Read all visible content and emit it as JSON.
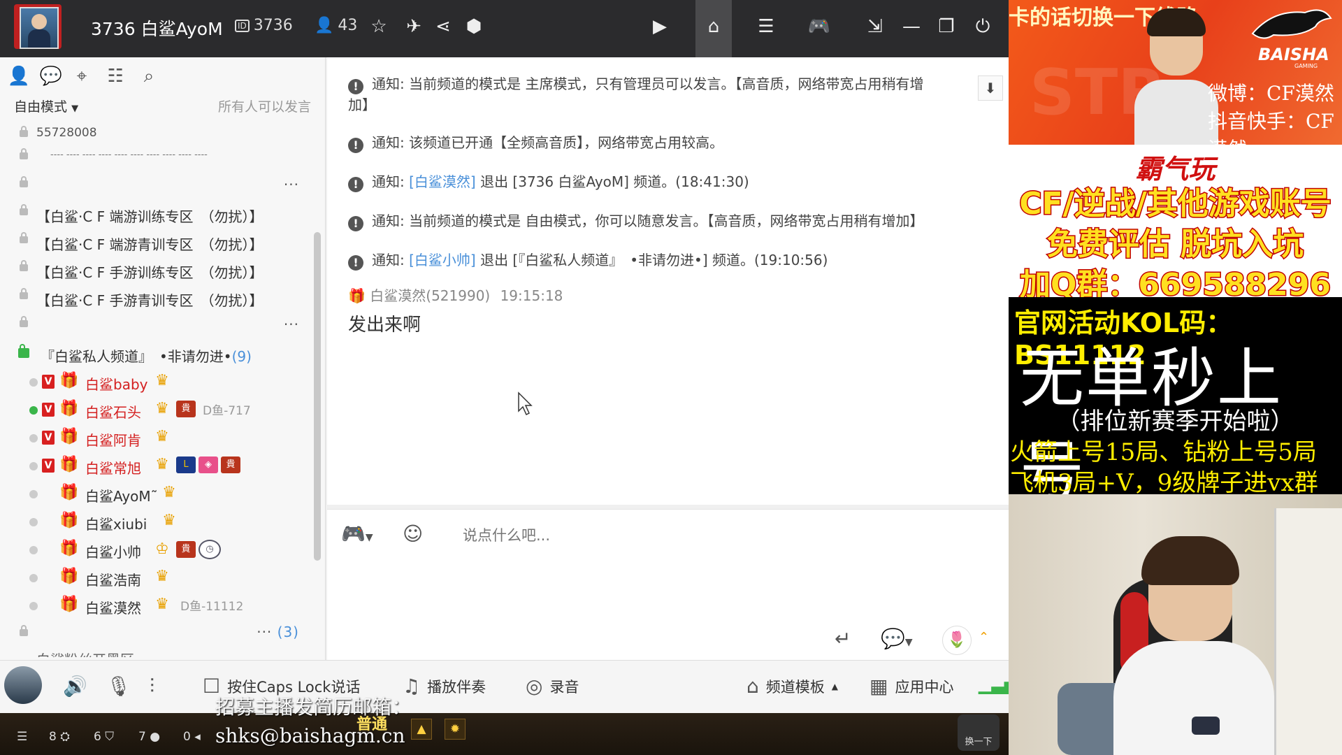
{
  "titlebar": {
    "channel_title": "3736 白鲨AyoM",
    "channel_id": "3736",
    "online_count": "43"
  },
  "left_panel": {
    "mode_label": "自由模式",
    "mode_hint": "所有人可以发言",
    "tree": [
      {
        "text": "55728008",
        "more": ""
      },
      {
        "text": "---- ---- ---- ---- ---- ---- ---- ---- ---- ----",
        "more": ""
      },
      {
        "text": "",
        "more": "···"
      },
      {
        "text": "【白鲨·C F 端游训练专区　（勿扰）】",
        "more": ""
      },
      {
        "text": "【白鲨·C F 端游青训专区　（勿扰）】",
        "more": ""
      },
      {
        "text": "【白鲨·C F 手游训练专区　（勿扰）】",
        "more": ""
      },
      {
        "text": "【白鲨·C F 手游青训专区　（勿扰）】",
        "more": ""
      },
      {
        "text": "",
        "more": "···"
      }
    ],
    "private_channel": {
      "name": "『白鲨私人频道』　•非请勿进•",
      "count": "(9)"
    },
    "users": [
      {
        "name": "白鲨baby",
        "red": true,
        "online": false,
        "vip": "V",
        "tail": ""
      },
      {
        "name": "白鲨石头",
        "red": true,
        "online": true,
        "vip": "V",
        "tail": "D鱼-717"
      },
      {
        "name": "白鲨阿肯",
        "red": true,
        "online": false,
        "vip": "V",
        "tail": ""
      },
      {
        "name": "白鲨常旭",
        "red": true,
        "online": false,
        "vip": "V",
        "tail": ""
      },
      {
        "name": "白鲨AyoM˜",
        "red": false,
        "online": false,
        "vip": "",
        "tail": ""
      },
      {
        "name": "白鲨xiubi",
        "red": false,
        "online": false,
        "vip": "",
        "tail": ""
      },
      {
        "name": "白鲨小帅",
        "red": false,
        "online": false,
        "vip": "",
        "tail": ""
      },
      {
        "name": "白鲨浩南",
        "red": false,
        "online": false,
        "vip": "",
        "tail": ""
      },
      {
        "name": "白鲨漠然",
        "red": false,
        "online": false,
        "vip": "",
        "tail": "D鱼-11112"
      }
    ],
    "after_more": "···",
    "after_count": "(3)",
    "last_row_partial": "白鲨粉丝开黑区"
  },
  "chat": {
    "notices": [
      {
        "prefix": "通知:",
        "a": "当前频道的模式是 主席模式，只有管理员可以发言。【高音质，网络带宽占用稍有增",
        "b": "加】"
      },
      {
        "prefix": "通知:",
        "a": "该频道已开通【全频高音质】，网络带宽占用较高。"
      },
      {
        "prefix": "通知:",
        "link": "[白鲨漠然]",
        "a": " 退出 [3736 白鲨AyoM] 频道。(18:41:30)"
      },
      {
        "prefix": "通知:",
        "a": "当前频道的模式是 自由模式，你可以随意发言。【高音质，网络带宽占用稍有增加】"
      },
      {
        "prefix": "通知:",
        "link": "[白鲨小帅]",
        "a": " 退出 [『白鲨私人频道』　•非请勿进•] 频道。(19:10:56)"
      }
    ],
    "message": {
      "sender": "白鲨漠然(521990)",
      "time": "19:15:18",
      "text": "发出来啊"
    },
    "input_placeholder": "说点什么吧..."
  },
  "bottombar": {
    "caps_label": "按住Caps Lock说话",
    "accompany_label": "播放伴奏",
    "record_label": "录音",
    "template_label": "频道模板",
    "app_center_label": "应用中心"
  },
  "strip": {
    "counts": [
      "8",
      "6",
      "7",
      "0"
    ],
    "putong": "普通",
    "switch_label": "换一下"
  },
  "overlay_text": {
    "hire_line1": "招募主播发简历邮箱：",
    "hire_line2": "shks@baishagm.cn"
  },
  "stream": {
    "banner_cut": "卡的话切换一下线路",
    "brand": "BAISHA",
    "brand_sub": "GAMING",
    "weibo": "微博：CF漠然",
    "douyin": "抖音快手：CF漠然",
    "ad_top": "霸气玩",
    "ad_line1": "CF/逆战/其他游戏账号",
    "ad_line2": "免费评估  脱坑入坑",
    "ad_line3": "加Q群：669588296",
    "kol": "官网活动KOL码：BS11112",
    "big": "无单秒上号",
    "season": "（排位新赛季开始啦）",
    "promo1": "火箭上号15局、钻粉上号5局",
    "promo2": "飞机3局+V，9级牌子进vx群"
  },
  "colors": {
    "accent_red": "#d42020",
    "link_blue": "#4a90d9",
    "online_green": "#3ab54a",
    "titlebar_bg": "#2b2b2d",
    "banner_orange": "#f35a1a"
  }
}
